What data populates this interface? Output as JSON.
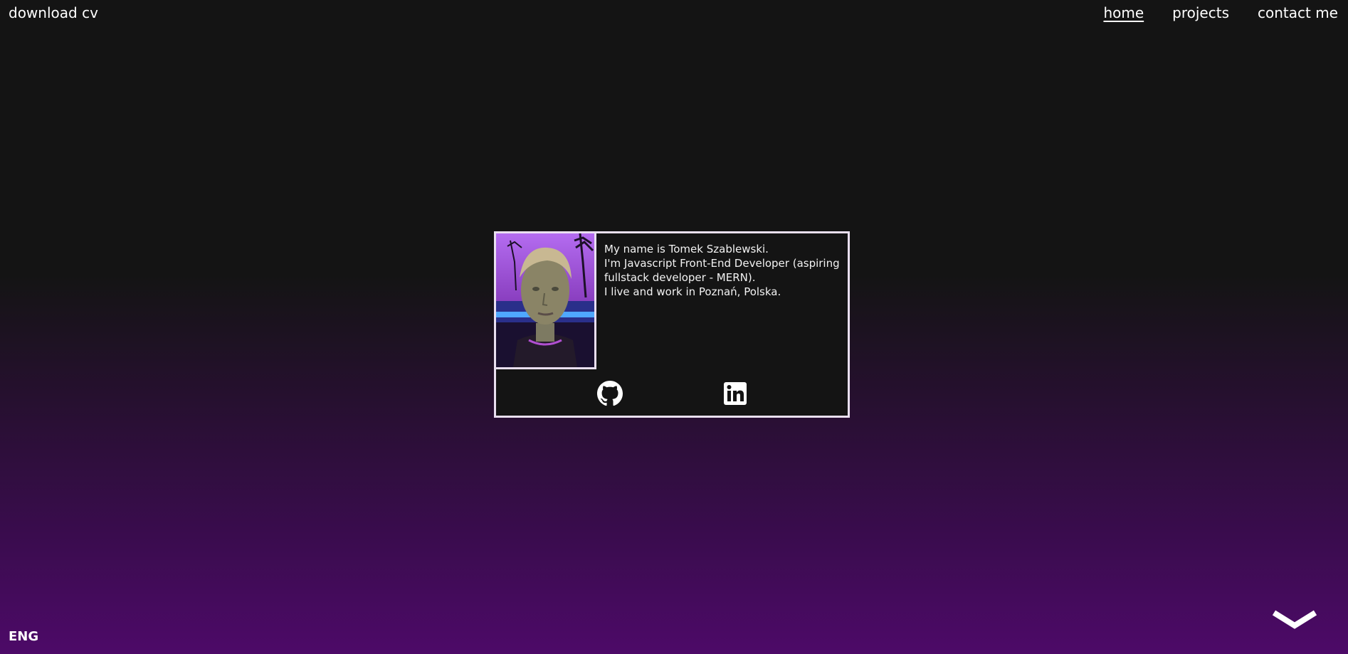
{
  "header": {
    "download_cv": "download cv",
    "nav": [
      {
        "label": "home",
        "active": true
      },
      {
        "label": "projects",
        "active": false
      },
      {
        "label": "contact me",
        "active": false
      }
    ]
  },
  "profile": {
    "bio_lines": [
      "My name is Tomek Szablewski.",
      "I'm Javascript Front-End Developer (aspiring fullstack developer - MERN).",
      "I live and work in Poznań, Polska."
    ],
    "socials": [
      {
        "icon": "github-icon"
      },
      {
        "icon": "linkedin-icon"
      }
    ]
  },
  "footer": {
    "language": "ENG",
    "scroll_icon": "chevron-down-icon"
  },
  "colors": {
    "background_top": "#141414",
    "background_bottom": "#4d0a68",
    "card_border": "#e9dff0",
    "text": "#ffffff"
  }
}
